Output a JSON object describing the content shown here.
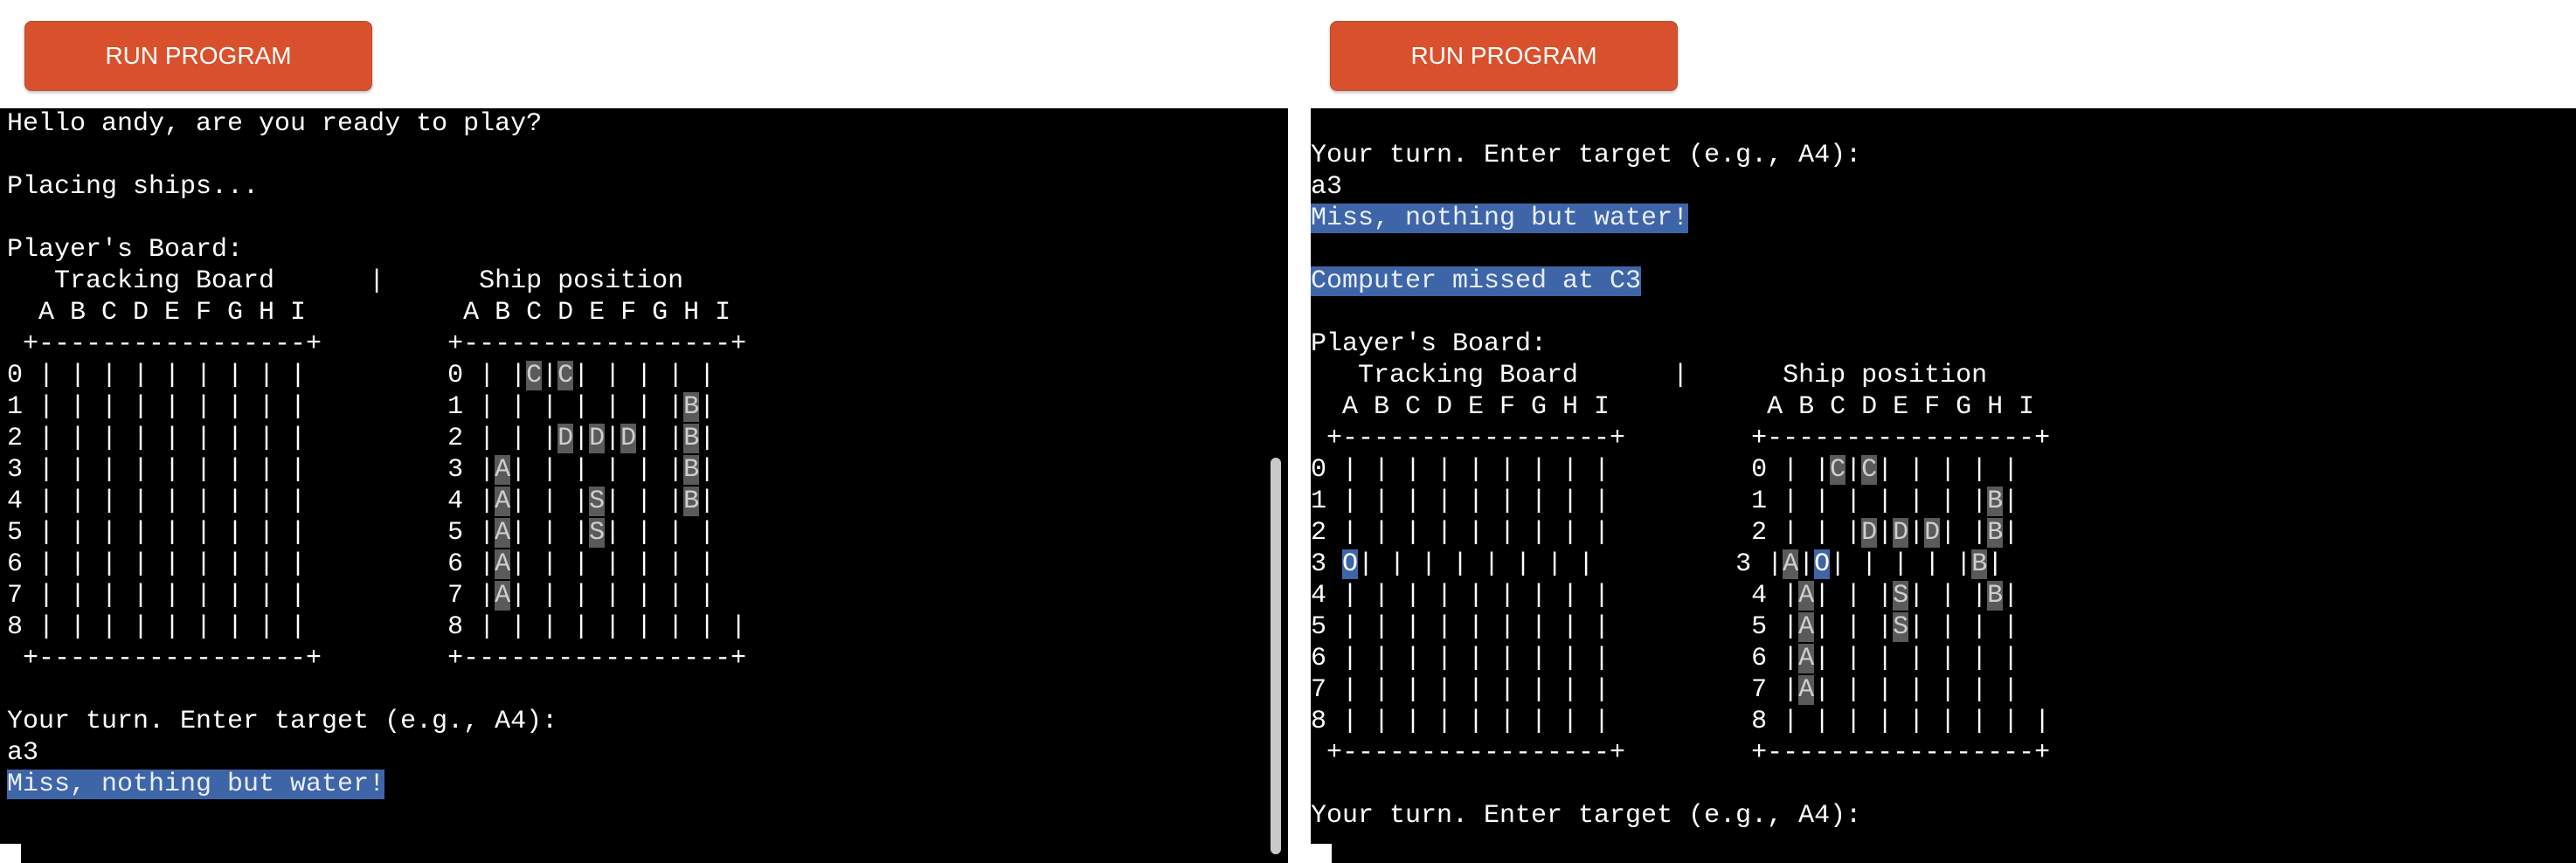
{
  "panels": [
    {
      "run_label": "RUN PROGRAM",
      "lines": [
        "Hello andy, are you ready to play?",
        "",
        "Placing ships...",
        "",
        "Player's Board:",
        "   Tracking Board      |      Ship position",
        "  A B C D E F G H I          A B C D E F G H I",
        " +-----------------+        +-----------------+",
        "0 | | | | | | | | |         0 | |{C}|{C}| | | | |",
        "1 | | | | | | | | |         1 | | | | | | |{B}|",
        "2 | | | | | | | | |         2 | | |{D}|{D}|{D}| |{B}|",
        "3 | | | | | | | | |         3 |{A}| | | | | |{B}|",
        "4 | | | | | | | | |         4 |{A}| | |{S}| | |{B}|",
        "5 | | | | | | | | |         5 |{A}| | |{S}| | | |",
        "6 | | | | | | | | |         6 |{A}| | | | | | |",
        "7 | | | | | | | | |         7 |{A}| | | | | | |",
        "8 | | | | | | | | |         8 | | | | | | | | |",
        " +-----------------+        +-----------------+",
        "",
        "Your turn. Enter target (e.g., A4):",
        "a3",
        "[[Miss, nothing but water!]]"
      ]
    },
    {
      "run_label": "RUN PROGRAM",
      "lines": [
        "",
        "Your turn. Enter target (e.g., A4):",
        "a3",
        "[[Miss, nothing but water!]]",
        "",
        "[[Computer missed at C3]]",
        "",
        "Player's Board:",
        "   Tracking Board      |      Ship position",
        "  A B C D E F G H I          A B C D E F G H I",
        " +-----------------+        +-----------------+",
        "0 | | | | | | | | |         0 | |{C}|{C}| | | | |",
        "1 | | | | | | | | |         1 | | | | | | |{B}|",
        "2 | | | | | | | | |         2 | | |{D}|{D}|{D}| |{B}|",
        "3 <O>| | | | | | | |         3 |{A}|<O>| | | | |{B}|",
        "4 | | | | | | | | |         4 |{A}| | |{S}| | |{B}|",
        "5 | | | | | | | | |         5 |{A}| | |{S}| | | |",
        "6 | | | | | | | | |         6 |{A}| | | | | | |",
        "7 | | | | | | | | |         7 |{A}| | | | | | |",
        "8 | | | | | | | | |         8 | | | | | | | | |",
        " +-----------------+        +-----------------+",
        "",
        "Your turn. Enter target (e.g., A4):"
      ]
    }
  ],
  "colors": {
    "run_button": "#d9512c",
    "terminal_bg": "#000000",
    "highlight": "#3e65a8"
  }
}
